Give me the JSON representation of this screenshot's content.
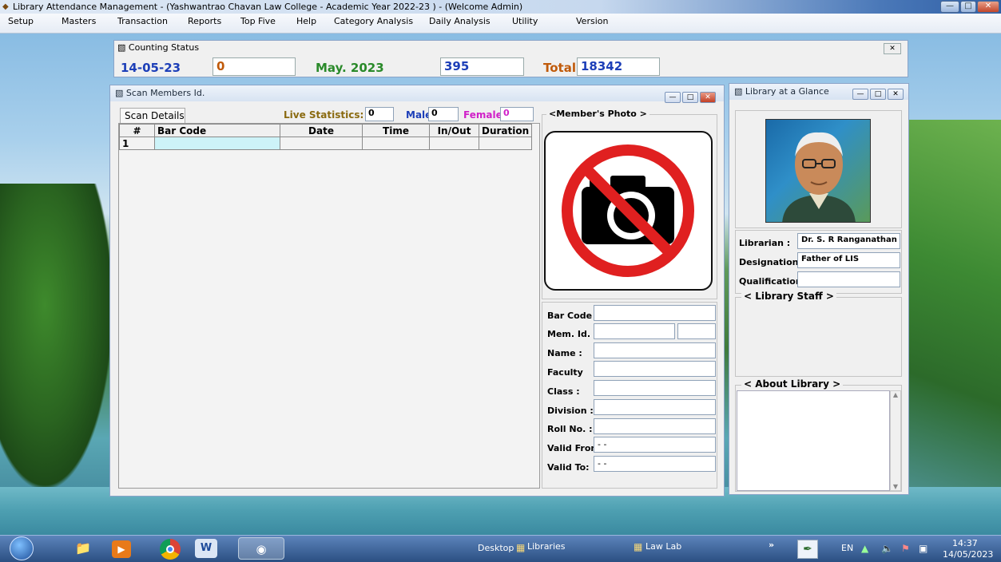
{
  "window": {
    "title": "Library Attendance Management - (Yashwantrao Chavan Law College - Academic Year 2022-23 ) - (Welcome Admin)"
  },
  "menu": [
    "Setup",
    "Masters",
    "Transaction",
    "Reports",
    "Top Five",
    "Help",
    "Category Analysis",
    "Daily Analysis",
    "Utility",
    "Version"
  ],
  "counting_status": {
    "title": "Counting Status",
    "date": "14-05-23",
    "today_count": "0",
    "month": "May. 2023",
    "month_count": "395",
    "total_label": "Total :",
    "total_value": "18342"
  },
  "scan_window": {
    "title": "Scan Members Id.",
    "tab": "Scan Details",
    "live_stats_label": "Live Statistics:",
    "live_stats_value": "0",
    "male_label": "Male",
    "male_value": "0",
    "female_label": "Female:",
    "female_value": "0",
    "columns": [
      "#",
      "Bar Code",
      "Date",
      "Time",
      "In/Out",
      "Duration"
    ],
    "rows": [
      [
        "1",
        "",
        "",
        "",
        "",
        ""
      ]
    ],
    "photo_label": "<Member's Photo >",
    "fields": [
      {
        "label": "Bar Code :",
        "value": ""
      },
      {
        "label": "Mem. Id. :",
        "value": ""
      },
      {
        "label": "Name :",
        "value": ""
      },
      {
        "label": "Faculty",
        "value": ""
      },
      {
        "label": "Class :",
        "value": ""
      },
      {
        "label": "Division :",
        "value": ""
      },
      {
        "label": "Roll No. :",
        "value": ""
      },
      {
        "label": "Valid From:",
        "value": "- -"
      },
      {
        "label": "Valid To:",
        "value": "- -"
      }
    ]
  },
  "glance": {
    "title": "Library at a Glance",
    "librarian_label": "Librarian :",
    "librarian_value": "Dr. S. R Ranganathan",
    "designation_label": "Designation:",
    "designation_value": "Father of LIS",
    "qualification_label": "Qualification:",
    "qualification_value": "",
    "staff_label": "< Library Staff >",
    "about_label": "< About Library >"
  },
  "taskbar": {
    "desktop": "Desktop",
    "libraries": "Libraries",
    "lawlab": "Law Lab",
    "lang": "EN",
    "time": "14:37",
    "date": "14/05/2023"
  },
  "colors": {
    "date_blue": "#1d3fb8",
    "today_orange": "#c05a0a",
    "month_green": "#2a8a2a",
    "total_orange": "#c05a0a",
    "female_magenta": "#d020c8"
  }
}
